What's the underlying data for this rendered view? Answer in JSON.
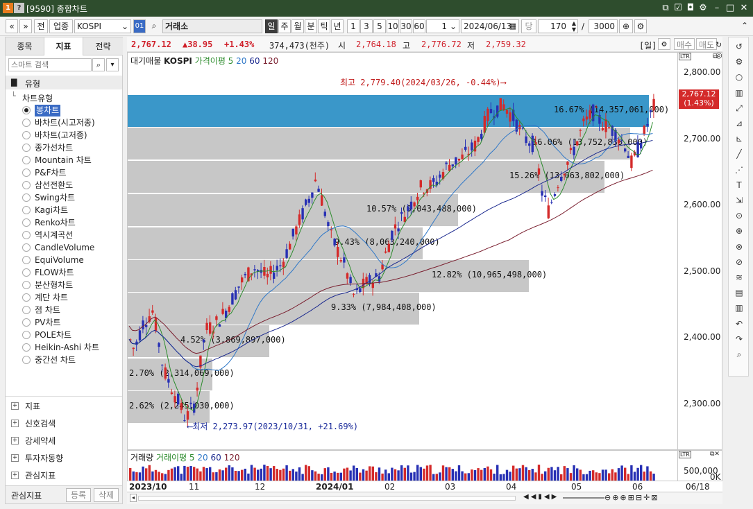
{
  "window": {
    "title": "[9590] 종합차트",
    "num_badge": "1",
    "help_badge": "?"
  },
  "toolbar": {
    "nav_prev": "«",
    "nav_down": "»",
    "btn_prev": "전",
    "sector_label": "업종",
    "index_value": "KOSPI",
    "code_box": "01",
    "market_label": "거래소",
    "periods": [
      "일",
      "주",
      "월",
      "분",
      "틱",
      "년"
    ],
    "intervals": [
      "1",
      "3",
      "5",
      "10",
      "30",
      "60"
    ],
    "count_value": "1",
    "date_value": "2024/06/13",
    "unit_label": "당",
    "bars_value": "170",
    "slash": "/",
    "total_value": "3000"
  },
  "price": {
    "last": "2,767.12",
    "change": "▲38.95",
    "pct": "+1.43%",
    "volume": "374,473(천주)",
    "open_label": "시",
    "open": "2,764.18",
    "high_label": "고",
    "high": "2,776.72",
    "low_label": "저",
    "low": "2,759.32",
    "period_tag": "[일]",
    "buy": "매수",
    "sell": "매도"
  },
  "left": {
    "tabs": [
      "종목",
      "지표",
      "전략"
    ],
    "search_placeholder": "스마트 검색",
    "folder": "유형",
    "chart_types_header": "차트유형",
    "chart_types": [
      "봉차트",
      "바차트(시고저종)",
      "바차트(고저종)",
      "종가선차트",
      "Mountain 차트",
      "P&F차트",
      "삼선전환도",
      "Swing차트",
      "Kagi차트",
      "Renko차트",
      "역시계곡선",
      "CandleVolume",
      "EquiVolume",
      "FLOW차트",
      "분산형차트",
      "계단 차트",
      "점 차트",
      "PV차트",
      "POLE차트",
      "Heikin-Ashi 차트",
      "중간선 차트"
    ],
    "sections": [
      "지표",
      "신호검색",
      "강세약세",
      "투자자동향",
      "관심지표"
    ],
    "footer_label": "관심지표",
    "register": "등록",
    "delete": "삭제"
  },
  "chart": {
    "legend": {
      "vp": "대기매물",
      "index": "KOSPI",
      "ma_label": "가격이평 5",
      "ma20": "20",
      "ma60": "60",
      "ma120": "120"
    },
    "high_note": "최고 2,779.40(2024/03/26, -0.44%)",
    "low_note": "최저 2,273.97(2023/10/31, +21.69%)",
    "last_tag": "2,767.12",
    "last_pct": "(1.43%)",
    "y_ticks": [
      "2,800.00",
      "2,700.00",
      "2,600.00",
      "2,500.00",
      "2,400.00",
      "2,300.00"
    ],
    "volume_profile": [
      {
        "label": "16.67% (14,357,061,000)",
        "pct": 16.67
      },
      {
        "label": "16.06% (13,752,835,000)",
        "pct": 16.06
      },
      {
        "label": "15.26% (13,063,802,000)",
        "pct": 15.26
      },
      {
        "label": "10.57% (9,043,488,000)",
        "pct": 10.57
      },
      {
        "label": "9.43% (8,063,240,000)",
        "pct": 9.43
      },
      {
        "label": "12.82% (10,965,498,000)",
        "pct": 12.82
      },
      {
        "label": "9.33% (7,984,408,000)",
        "pct": 9.33
      },
      {
        "label": "4.52% (3,869,897,000)",
        "pct": 4.52
      },
      {
        "label": "2.70% (2,314,069,000)",
        "pct": 2.7
      },
      {
        "label": "2.62% (2,245,030,000)",
        "pct": 2.62
      }
    ],
    "colors": {
      "up": "#d42a2a",
      "down": "#2730b4",
      "vp": "#c7c7c7",
      "vp_top": "#3a97c9",
      "ma5": "#2d8c2d",
      "ma20": "#2f78c8",
      "ma60": "#1c2a8f",
      "ma120": "#7a1f2f"
    }
  },
  "volume": {
    "legend_label": "거래량",
    "ma_label": "거래이평 5",
    "ma20": "20",
    "ma60": "60",
    "ma120": "120",
    "axis_label": "500,000",
    "unit": "0K"
  },
  "xaxis": {
    "labels": [
      "2023/10",
      "11",
      "12",
      "2024/01",
      "02",
      "03",
      "04",
      "05",
      "06"
    ],
    "right_label": "06/18"
  }
}
